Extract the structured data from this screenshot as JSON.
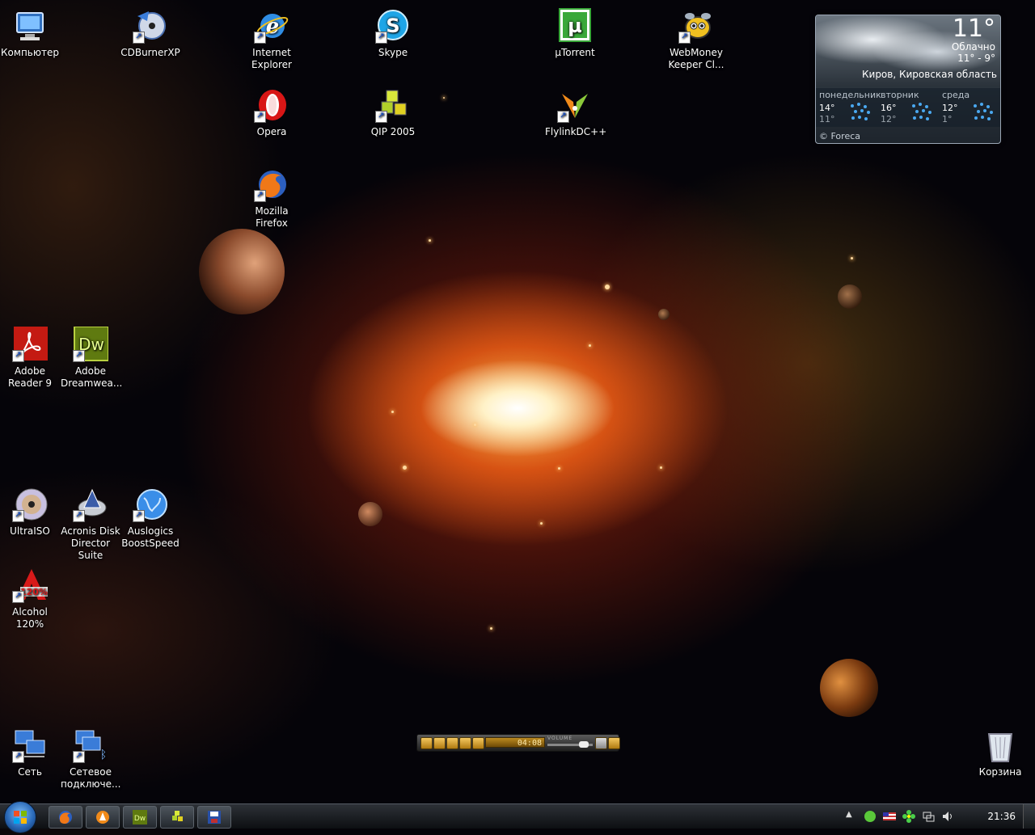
{
  "desktop": {
    "icons": {
      "computer": "Компьютер",
      "cdburner": "CDBurnerXP",
      "ie": "Internet\nExplorer",
      "skype": "Skype",
      "utorrent": "µTorrent",
      "webmoney": "WebMoney\nKeeper Cl...",
      "opera": "Opera",
      "qip": "QIP 2005",
      "flylink": "FlylinkDC++",
      "firefox": "Mozilla\nFirefox",
      "adobe_reader": "Adobe\nReader 9",
      "dreamweaver": "Adobe\nDreamwea...",
      "ultraiso": "UltraISO",
      "acronis": "Acronis Disk\nDirector Suite",
      "auslogics": "Auslogics\nBoostSpeed",
      "alcohol": "Alcohol\n120%",
      "network": "Сеть",
      "connections": "Сетевое\nподключе...",
      "recycle": "Корзина"
    },
    "icon_glyphs": {
      "dreamweaver": "Dw",
      "alcohol": "120%",
      "utorrent": "µ",
      "opera": "O"
    }
  },
  "weather": {
    "temp": "11°",
    "condition": "Облачно",
    "range": "11° - 9°",
    "city": "Киров, Кировская область",
    "days": [
      {
        "name": "понедельник",
        "hi": "14°",
        "lo": "11°"
      },
      {
        "name": "вторник",
        "hi": "16°",
        "lo": "12°"
      },
      {
        "name": "среда",
        "hi": "12°",
        "lo": "1°"
      }
    ],
    "footer": "© Foreca"
  },
  "player": {
    "time": "04:08",
    "volume_label": "VOLUME",
    "volume_level": 0.8
  },
  "taskbar": {
    "clock": "21:36",
    "buttons": [
      "firefox-icon",
      "avast-icon",
      "dreamweaver-icon",
      "qip-icon",
      "floppy-save-icon"
    ],
    "dw_glyph": "Dw"
  },
  "colors": {
    "taskbar": "#1a1d21",
    "desktop_background": "#050409",
    "nebula_core": "#ffe9b0"
  }
}
